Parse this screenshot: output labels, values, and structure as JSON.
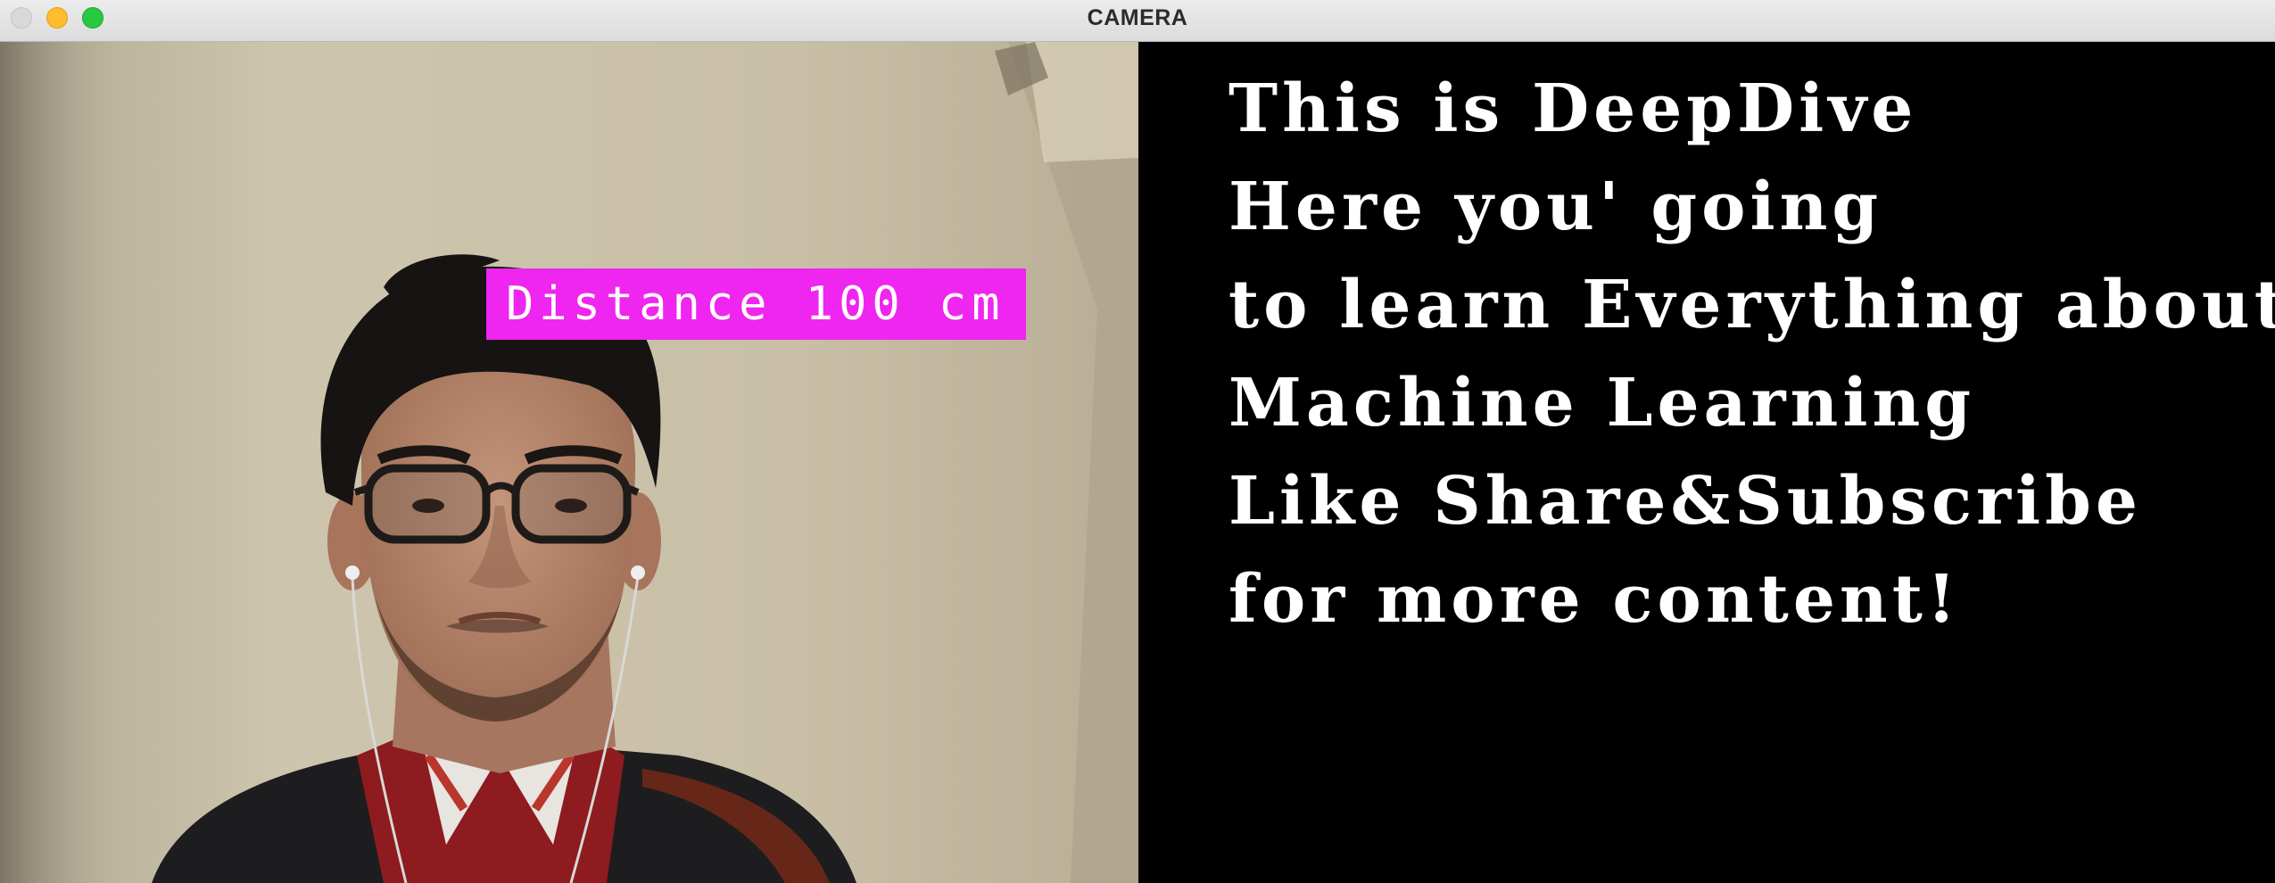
{
  "window": {
    "title": "CAMERA",
    "controls": {
      "close_icon": "close-icon",
      "minimize_icon": "minimize-icon",
      "maximize_icon": "maximize-icon",
      "colors": {
        "close": "#d9d9d9",
        "minimize": "#febc2e",
        "maximize": "#28c840"
      }
    }
  },
  "camera": {
    "overlay_label": "Distance 100 cm",
    "overlay_color": "#ef26ef"
  },
  "text_panel": {
    "lines": [
      "This is DeepDive",
      "Here you' going",
      "to learn Everything about",
      "Machine Learning",
      "Like Share&Subscribe",
      "for more content!"
    ],
    "text_color": "#ffffff",
    "background": "#000000"
  }
}
